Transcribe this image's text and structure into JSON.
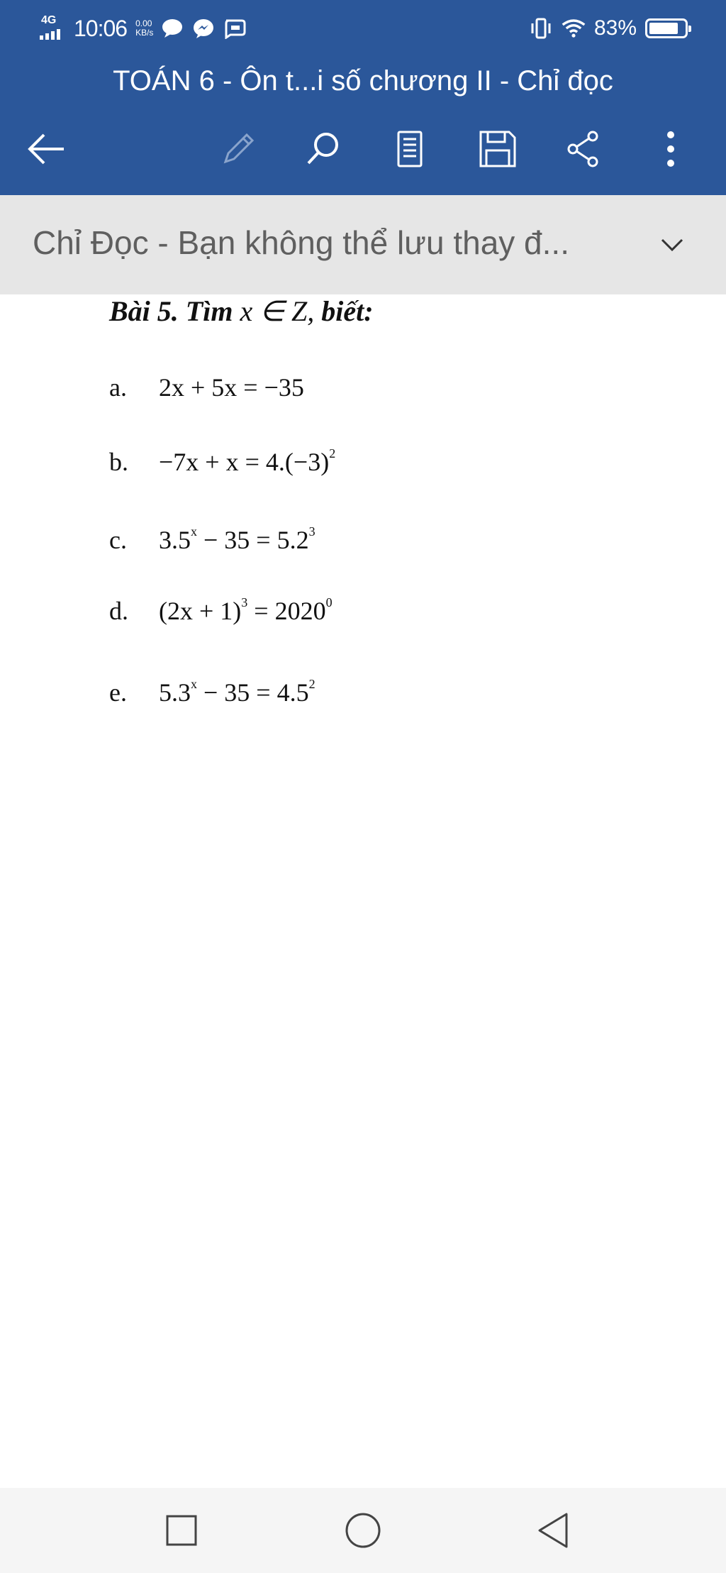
{
  "status_bar": {
    "network_type": "4G",
    "time": "10:06",
    "net_speed_value": "0.00",
    "net_speed_unit": "KB/s",
    "notification_icons": [
      "chat-bubble-icon",
      "messenger-icon",
      "zalo-icon"
    ],
    "battery_percent": "83%",
    "battery_level": 0.83
  },
  "header": {
    "title": "TOÁN 6 - Ôn t...i số chương II - Chỉ đọc",
    "background_color": "#2b579a"
  },
  "toolbar": {
    "back_icon": "back-arrow-icon",
    "buttons": [
      "edit-pencil-icon",
      "search-icon",
      "mobile-view-icon",
      "save-icon",
      "share-icon",
      "more-options-icon"
    ]
  },
  "readonly_banner": {
    "text": "Chỉ Đọc - Bạn không thể lưu thay đ...",
    "chevron": "chevron-down-icon"
  },
  "document": {
    "heading_prefix": "Bài 5. Tìm",
    "heading_math": "x ∈ Z,",
    "heading_suffix": "biết:",
    "problems": [
      {
        "letter": "a.",
        "expr": "2x + 5x = −35"
      },
      {
        "letter": "b.",
        "base": "−7x + x = 4.(−3)",
        "exp": "2"
      },
      {
        "letter": "c.",
        "part1": "3.5",
        "exp1": "x",
        "part2": " − 35 = 5.2",
        "exp2": "3"
      },
      {
        "letter": "d.",
        "part1": "(2x + 1)",
        "exp1": "3",
        "part2": " = 2020",
        "exp2": "0"
      },
      {
        "letter": "e.",
        "part1": "5.3",
        "exp1": "x",
        "part2": " − 35 = 4.5",
        "exp2": "2"
      }
    ]
  },
  "nav_bar": {
    "buttons": [
      "recent-apps-square-icon",
      "home-circle-icon",
      "back-triangle-icon"
    ]
  }
}
